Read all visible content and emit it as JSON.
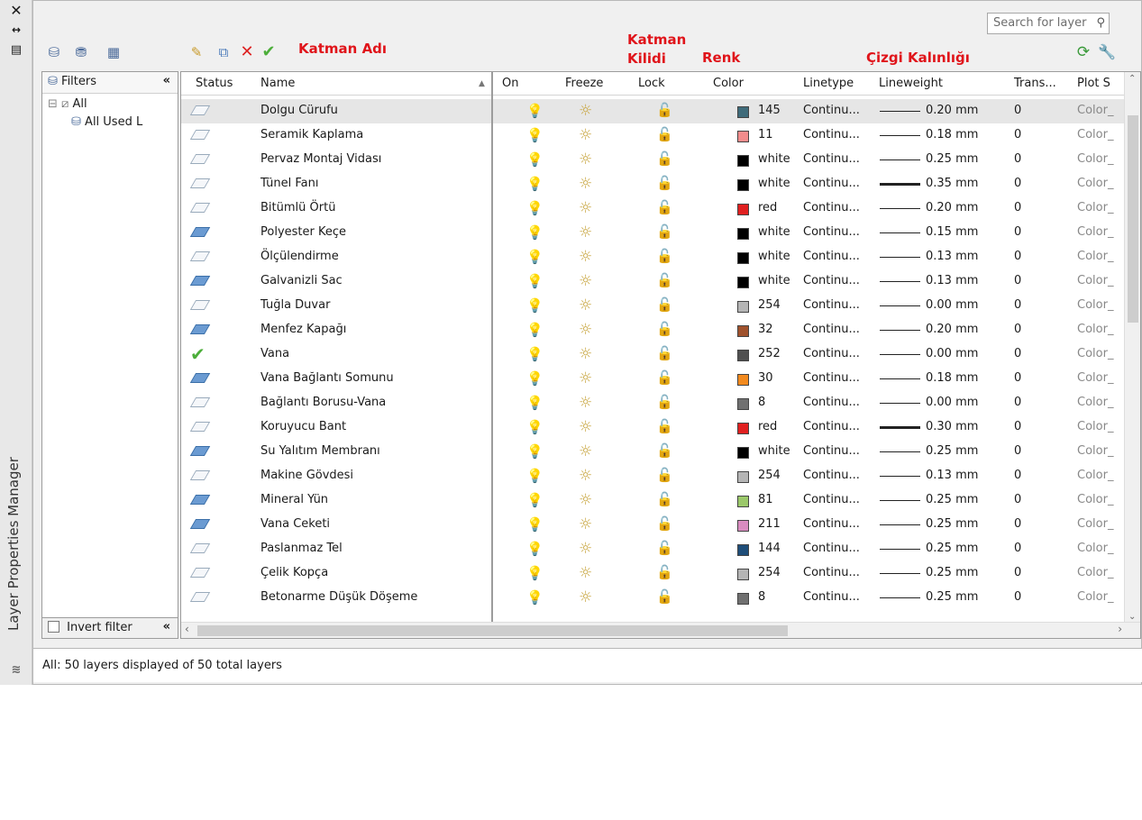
{
  "window": {
    "title": "Layer Properties Manager",
    "close_icon": "close-icon",
    "autohide_icon": "autohide-icon",
    "properties_icon": "properties-icon"
  },
  "search": {
    "placeholder": "Search for layer"
  },
  "annotations": {
    "katman_adi": "Katman Adı",
    "katman_kilidi_1": "Katman",
    "katman_kilidi_2": "Kilidi",
    "renk": "Renk",
    "cizgi_kalinligi": "Çizgi Kalınlığı"
  },
  "filters": {
    "header": "Filters",
    "collapse": "«",
    "tree": [
      {
        "label": "All"
      },
      {
        "label": "All Used L"
      }
    ],
    "invert_label": "Invert filter",
    "invert_collapse": "«"
  },
  "columns": [
    "Status",
    "Name",
    "On",
    "Freeze",
    "Lock",
    "Color",
    "Linetype",
    "Lineweight",
    "Trans...",
    "Plot S"
  ],
  "layers": [
    {
      "status": "plain",
      "name": "Dolgu Cürufu",
      "color_hex": "#3f6b7a",
      "color": "145",
      "linetype": "Continu...",
      "lineweight": "0.20 mm",
      "thick": false,
      "trans": "0",
      "plot": "Color_",
      "selected": true
    },
    {
      "status": "plain",
      "name": "Seramik Kaplama",
      "color_hex": "#f28c8c",
      "color": "11",
      "linetype": "Continu...",
      "lineweight": "0.18 mm",
      "thick": false,
      "trans": "0",
      "plot": "Color_"
    },
    {
      "status": "plain",
      "name": "Pervaz Montaj Vidası",
      "color_hex": "#000000",
      "color": "white",
      "linetype": "Continu...",
      "lineweight": "0.25 mm",
      "thick": false,
      "trans": "0",
      "plot": "Color_"
    },
    {
      "status": "plain",
      "name": "Tünel Fanı",
      "color_hex": "#000000",
      "color": "white",
      "linetype": "Continu...",
      "lineweight": "0.35 mm",
      "thick": true,
      "trans": "0",
      "plot": "Color_"
    },
    {
      "status": "plain",
      "name": "Bitümlü Örtü",
      "color_hex": "#e02020",
      "color": "red",
      "linetype": "Continu...",
      "lineweight": "0.20 mm",
      "thick": false,
      "trans": "0",
      "plot": "Color_"
    },
    {
      "status": "blue",
      "name": "Polyester Keçe",
      "color_hex": "#000000",
      "color": "white",
      "linetype": "Continu...",
      "lineweight": "0.15 mm",
      "thick": false,
      "trans": "0",
      "plot": "Color_"
    },
    {
      "status": "plain",
      "name": "Ölçülendirme",
      "color_hex": "#000000",
      "color": "white",
      "linetype": "Continu...",
      "lineweight": "0.13 mm",
      "thick": false,
      "trans": "0",
      "plot": "Color_"
    },
    {
      "status": "blue",
      "name": "Galvanizli Sac",
      "color_hex": "#000000",
      "color": "white",
      "linetype": "Continu...",
      "lineweight": "0.13 mm",
      "thick": false,
      "trans": "0",
      "plot": "Color_"
    },
    {
      "status": "plain",
      "name": "Tuğla Duvar",
      "color_hex": "#b5b5b5",
      "color": "254",
      "linetype": "Continu...",
      "lineweight": "0.00 mm",
      "thick": false,
      "trans": "0",
      "plot": "Color_"
    },
    {
      "status": "blue",
      "name": "Menfez Kapağı",
      "color_hex": "#a0522d",
      "color": "32",
      "linetype": "Continu...",
      "lineweight": "0.20 mm",
      "thick": false,
      "trans": "0",
      "plot": "Color_"
    },
    {
      "status": "check",
      "name": "Vana",
      "color_hex": "#505050",
      "color": "252",
      "linetype": "Continu...",
      "lineweight": "0.00 mm",
      "thick": false,
      "trans": "0",
      "plot": "Color_"
    },
    {
      "status": "blue",
      "name": "Vana Bağlantı Somunu",
      "color_hex": "#f28a1e",
      "color": "30",
      "linetype": "Continu...",
      "lineweight": "0.18 mm",
      "thick": false,
      "trans": "0",
      "plot": "Color_"
    },
    {
      "status": "plain",
      "name": "Bağlantı Borusu-Vana",
      "color_hex": "#707070",
      "color": "8",
      "linetype": "Continu...",
      "lineweight": "0.00 mm",
      "thick": false,
      "trans": "0",
      "plot": "Color_"
    },
    {
      "status": "plain",
      "name": "Koruyucu Bant",
      "color_hex": "#e02020",
      "color": "red",
      "linetype": "Continu...",
      "lineweight": "0.30 mm",
      "thick": true,
      "trans": "0",
      "plot": "Color_"
    },
    {
      "status": "blue",
      "name": "Su Yalıtım Membranı",
      "color_hex": "#000000",
      "color": "white",
      "linetype": "Continu...",
      "lineweight": "0.25 mm",
      "thick": false,
      "trans": "0",
      "plot": "Color_"
    },
    {
      "status": "plain",
      "name": "Makine Gövdesi",
      "color_hex": "#b5b5b5",
      "color": "254",
      "linetype": "Continu...",
      "lineweight": "0.13 mm",
      "thick": false,
      "trans": "0",
      "plot": "Color_"
    },
    {
      "status": "blue",
      "name": "Mineral Yün",
      "color_hex": "#9bc86a",
      "color": "81",
      "linetype": "Continu...",
      "lineweight": "0.25 mm",
      "thick": false,
      "trans": "0",
      "plot": "Color_"
    },
    {
      "status": "blue",
      "name": "Vana Ceketi",
      "color_hex": "#d98cc0",
      "color": "211",
      "linetype": "Continu...",
      "lineweight": "0.25 mm",
      "thick": false,
      "trans": "0",
      "plot": "Color_"
    },
    {
      "status": "plain",
      "name": "Paslanmaz Tel",
      "color_hex": "#1f4e79",
      "color": "144",
      "linetype": "Continu...",
      "lineweight": "0.25 mm",
      "thick": false,
      "trans": "0",
      "plot": "Color_"
    },
    {
      "status": "plain",
      "name": "Çelik Kopça",
      "color_hex": "#b5b5b5",
      "color": "254",
      "linetype": "Continu...",
      "lineweight": "0.25 mm",
      "thick": false,
      "trans": "0",
      "plot": "Color_"
    },
    {
      "status": "plain",
      "name": "Betonarme Düşük Döşeme",
      "color_hex": "#707070",
      "color": "8",
      "linetype": "Continu...",
      "lineweight": "0.25 mm",
      "thick": false,
      "trans": "0",
      "plot": "Color_"
    }
  ],
  "statusbar": {
    "text": "All: 50 layers displayed of 50 total layers"
  }
}
